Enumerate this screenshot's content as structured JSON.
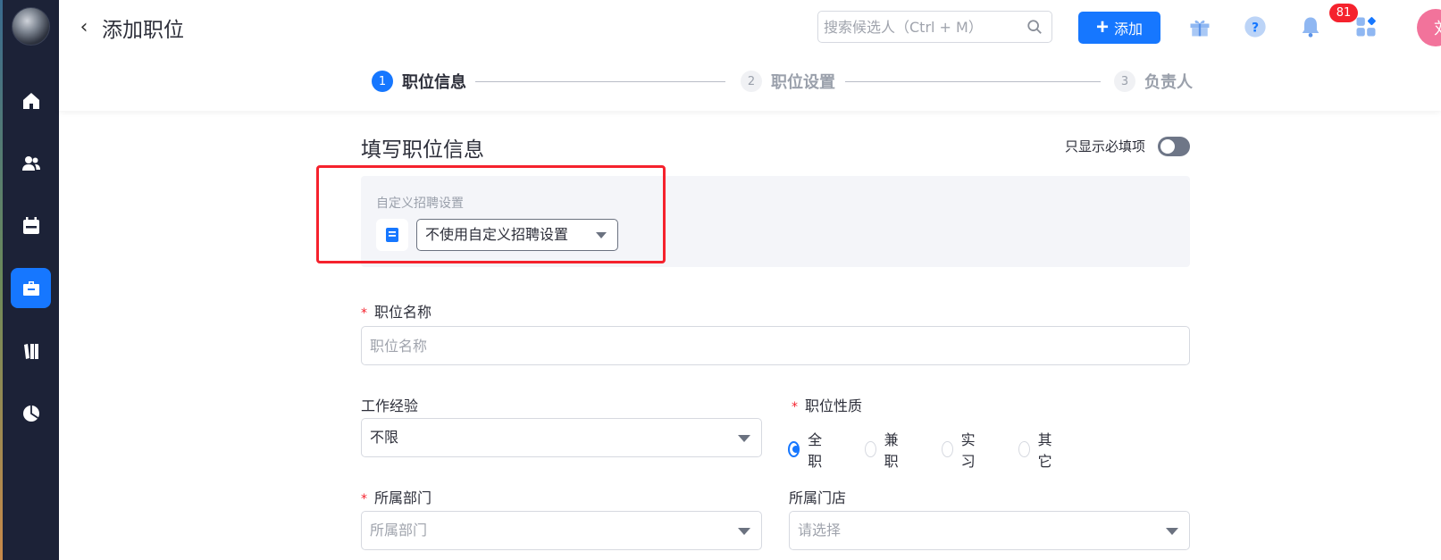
{
  "header": {
    "back_icon": "‹",
    "title": "添加职位",
    "search_placeholder": "搜索候选人（Ctrl + M）",
    "add_label": "添加",
    "notification_count": "81",
    "user_avatar_text": "刘"
  },
  "steps": [
    {
      "num": "1",
      "label": "职位信息"
    },
    {
      "num": "2",
      "label": "职位设置"
    },
    {
      "num": "3",
      "label": "负责人"
    }
  ],
  "form": {
    "section_title": "填写职位信息",
    "required_only_label": "只显示必填项",
    "custom_settings_label": "自定义招聘设置",
    "custom_settings_value": "不使用自定义招聘设置",
    "required_mark": "*",
    "position_name_label": "职位名称",
    "position_name_placeholder": "职位名称",
    "experience_label": "工作经验",
    "experience_value": "不限",
    "position_type_label": "职位性质",
    "position_type_options": [
      "全职",
      "兼职",
      "实习",
      "其它"
    ],
    "department_label": "所属部门",
    "department_placeholder": "所属部门",
    "store_label": "所属门店",
    "store_placeholder": "请选择"
  },
  "colors": {
    "accent": "#1677ff",
    "sidebar_bg": "#1c2237",
    "highlight": "#f5222d"
  }
}
